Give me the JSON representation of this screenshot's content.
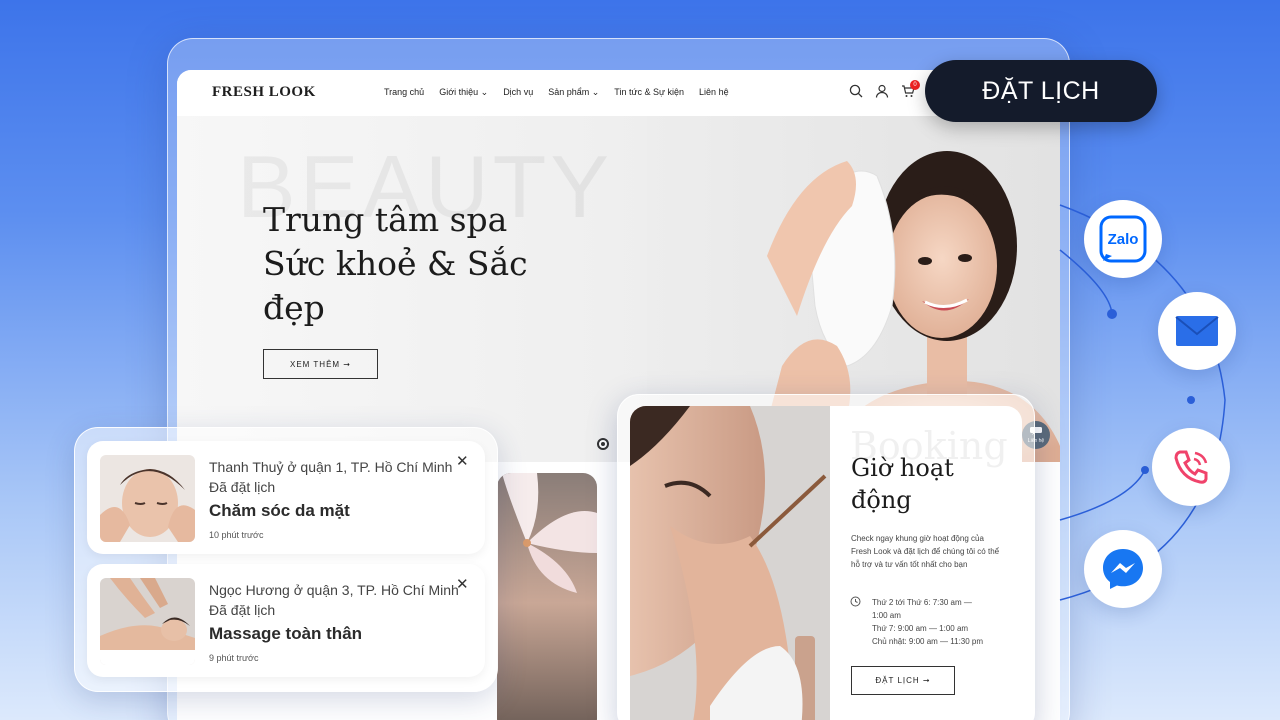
{
  "site": {
    "logo": "FRESH LOOK",
    "nav": [
      "Trang chủ",
      "Giới thiệu",
      "Dịch vụ",
      "Sản phẩm",
      "Tin tức & Sự kiện",
      "Liên hệ"
    ],
    "cart_count": "0"
  },
  "hero": {
    "bg_word": "BEAUTY",
    "title_line1": "Trung tâm spa",
    "title_line2": "Sức khoẻ & Sắc",
    "title_line3": "đẹp",
    "button": "XEM THÊM ➞",
    "chat_label": "Liên hệ"
  },
  "booking": {
    "ghost_word": "Booking",
    "title_line1": "Giờ hoạt",
    "title_line2": "động",
    "description": "Check ngay khung giờ hoạt động của Fresh Look và đặt lịch để chúng tôi có thể hỗ trợ và tư vấn tốt nhất cho bạn",
    "hours": [
      "Thứ 2 tới Thứ 6: 7:30 am —",
      "1:00 am",
      "Thứ 7: 9:00 am — 1:00 am",
      "Chủ nhật: 9:00 am — 11:30 pm"
    ],
    "button": "ĐẶT LỊCH ➞"
  },
  "notifications": [
    {
      "who": "Thanh Thuỷ ở quận 1, TP. Hồ Chí Minh",
      "action": "Đã đặt lịch",
      "service": "Chăm sóc da mặt",
      "time": "10 phút trước"
    },
    {
      "who": "Ngọc Hương ở quận 3, TP. Hồ Chí Minh",
      "action": "Đã đặt lịch",
      "service": "Massage toàn thân",
      "time": "9 phút trước"
    }
  ],
  "cta": {
    "label": "ĐẶT LỊCH"
  },
  "contacts": {
    "zalo": "Zalo"
  },
  "colors": {
    "accent": "#141b2b",
    "zalo": "#0068ff",
    "phone": "#f0436b",
    "messenger": "#1877f2"
  }
}
